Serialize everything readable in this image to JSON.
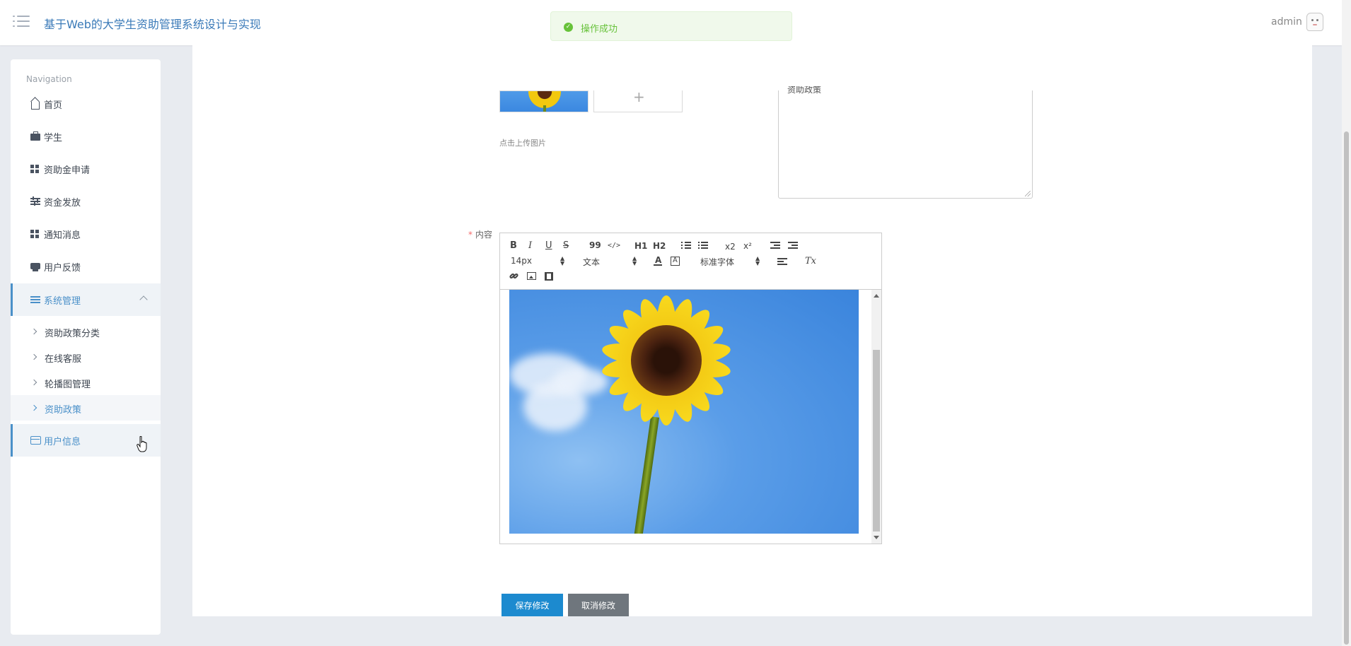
{
  "header": {
    "title": "基于Web的大学生资助管理系统设计与实现",
    "user": "admin"
  },
  "toast": {
    "message": "操作成功",
    "type": "success"
  },
  "sidebar": {
    "heading": "Navigation",
    "items": [
      {
        "label": "首页",
        "icon": "home-icon"
      },
      {
        "label": "学生",
        "icon": "briefcase-icon"
      },
      {
        "label": "资助金申请",
        "icon": "grid-icon"
      },
      {
        "label": "资金发放",
        "icon": "sliders-icon"
      },
      {
        "label": "通知消息",
        "icon": "grid-icon"
      },
      {
        "label": "用户反馈",
        "icon": "printer-icon"
      },
      {
        "label": "系统管理",
        "icon": "list-icon",
        "expanded": true
      },
      {
        "label": "用户信息",
        "icon": "card-icon"
      }
    ],
    "sub_items": [
      "资助政策分类",
      "在线客服",
      "轮播图管理",
      "资助政策"
    ]
  },
  "form": {
    "upload_hint": "点击上传图片",
    "textarea_value": "资助政策",
    "content_label": "内容",
    "required_mark": "*"
  },
  "editor": {
    "toolbar_row1": [
      "B",
      "I",
      "U",
      "S",
      "99",
      "</>",
      "H1",
      "H2",
      "x2",
      "x²"
    ],
    "font_size": "14px",
    "header_style": "文本",
    "font_family": "标准字体",
    "clear_format": "Tx"
  },
  "buttons": {
    "save": "保存修改",
    "cancel": "取消修改"
  },
  "colors": {
    "accent": "#4a90c9",
    "save_button": "#1c8acf",
    "cancel_button": "#6f767d",
    "toast_bg": "#f0f9eb",
    "toast_text": "#67c23a"
  }
}
